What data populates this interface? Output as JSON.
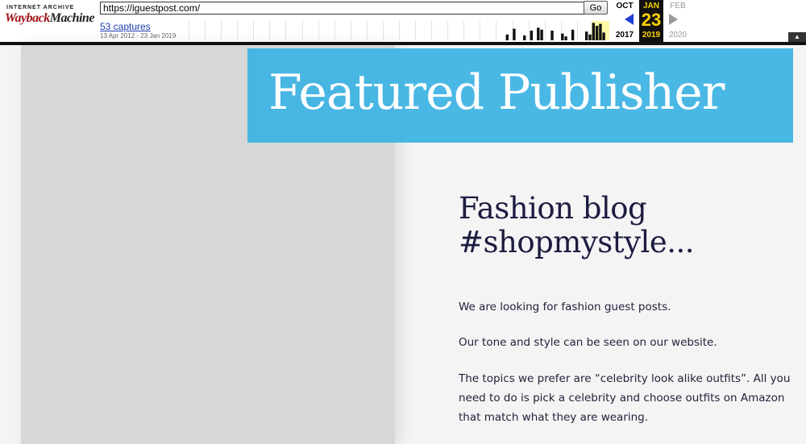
{
  "toolbar": {
    "logo_top": "INTERNET ARCHIVE",
    "logo_wayback": "Wayback",
    "logo_machine": "Machine",
    "url_value": "https://iguestpost.com/",
    "go_label": "Go",
    "captures_label": "53 captures",
    "captures_range": "13 Apr 2012 - 23 Jan 2019",
    "sparkline_bars": [
      0,
      0,
      0,
      0,
      0,
      0,
      0,
      0,
      0,
      0,
      0,
      0,
      0,
      0,
      0,
      0,
      0,
      0,
      0,
      0,
      0,
      0,
      0,
      0,
      0,
      0,
      0,
      0,
      0,
      0,
      0,
      0,
      0,
      0,
      0,
      0,
      0,
      0,
      0,
      0,
      0,
      0,
      0,
      0,
      0,
      0,
      0,
      0,
      0,
      0,
      0,
      0,
      0,
      0,
      0,
      0,
      0,
      0,
      0,
      0,
      0,
      0,
      0,
      0,
      0,
      0,
      0,
      0,
      0,
      0,
      0,
      0,
      0,
      0,
      0,
      0,
      0,
      0,
      0,
      0,
      0,
      0,
      0,
      0,
      0,
      0,
      0,
      0,
      0,
      0,
      0,
      0,
      0.3,
      0,
      0.6,
      0,
      0,
      0.25,
      0,
      0.5,
      0,
      0.65,
      0.55,
      0,
      0,
      0.5,
      0,
      0,
      0.35,
      0.2,
      0,
      0.55,
      0,
      0,
      0,
      0.45,
      0.3,
      0.9,
      0.75,
      0.85,
      0.4,
      0
    ],
    "prev_month": "OCT",
    "prev_year": "2017",
    "current_month": "JAN",
    "current_day": "23",
    "current_year": "2019",
    "next_month": "FEB",
    "next_year": "2020",
    "collapse_label": "▲"
  },
  "page": {
    "banner_title": "Featured Publisher",
    "heading": "Fashion blog #shopmystyle...",
    "paragraphs": [
      "We are looking for fashion guest posts.",
      "Our tone and style can be seen on our website.",
      "The topics we prefer are “celebrity look alike outfits”. All you need to do is pick a celebrity and choose outfits on Amazon that match what they are wearing."
    ]
  },
  "colors": {
    "banner": "#40b4e4",
    "heading": "#1c1c40",
    "highlight_year": "#ffd200",
    "prev_arrow": "#1d3fd4"
  }
}
